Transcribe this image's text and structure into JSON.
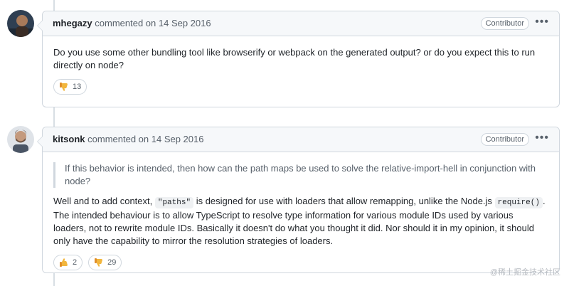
{
  "comments": [
    {
      "author": "mhegazy",
      "meta": "commented on 14 Sep 2016",
      "badge": "Contributor",
      "body": "Do you use some other bundling tool like browserify or webpack on the generated output? or do you expect this to run directly on node?",
      "reactions": [
        {
          "icon": "thumbs-down-icon",
          "count": "13"
        }
      ]
    },
    {
      "author": "kitsonk",
      "meta": "commented on 14 Sep 2016",
      "badge": "Contributor",
      "quote": "If this behavior is intended, then how can the path maps be used to solve the relative-import-hell in conjunction with node?",
      "paragraph": {
        "part1": "Well and to add context, ",
        "code1": "\"paths\"",
        "part2": " is designed for use with loaders that allow remapping, unlike the Node.js ",
        "code2": "require()",
        "part3": ". The intended behaviour is to allow TypeScript to resolve type information for various module IDs used by various loaders, not to rewrite module IDs. Basically it doesn't do what you thought it did. Nor should it in my opinion, it should only have the capability to mirror the resolution strategies of loaders."
      },
      "reactions": [
        {
          "icon": "thumbs-up-icon",
          "count": "2"
        },
        {
          "icon": "thumbs-down-icon",
          "count": "29"
        }
      ]
    }
  ],
  "watermark": "@稀土掘金技术社区",
  "colors": {
    "border": "#d0d7de",
    "header_bg": "#f6f8fa",
    "muted": "#57606a",
    "emoji": "#f2b63d"
  }
}
